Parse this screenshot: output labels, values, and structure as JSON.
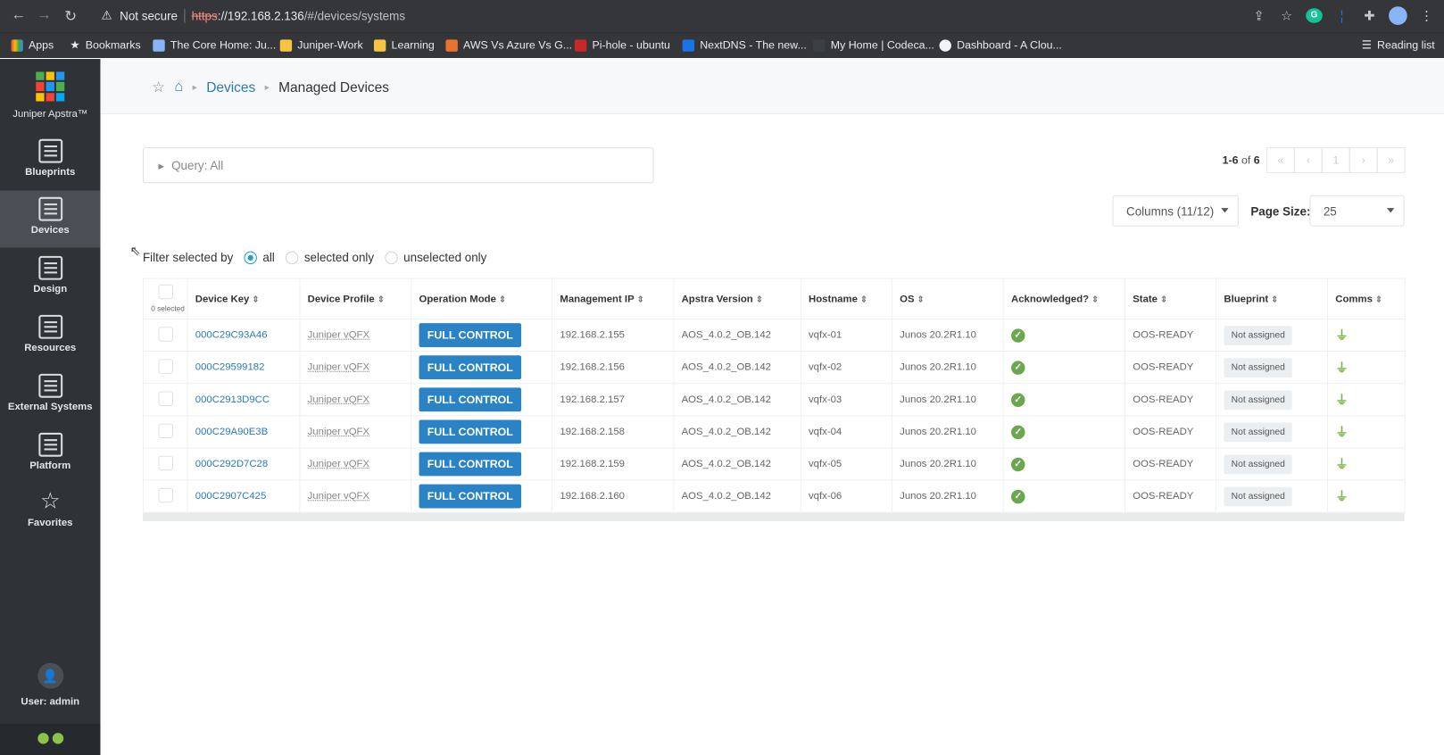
{
  "browser": {
    "not_secure": "Not secure",
    "url_proto": "https",
    "url_host": "://192.168.2.136",
    "url_path": "/#/devices/systems",
    "bookmarks": [
      {
        "label": "Apps",
        "color": "#ea4335"
      },
      {
        "label": "Bookmarks",
        "color": "#e8eaed"
      },
      {
        "label": "The Core Home: Ju...",
        "color": "#8ab4f8"
      },
      {
        "label": "Juniper-Work",
        "color": "#f6c343"
      },
      {
        "label": "Learning",
        "color": "#f6c343"
      },
      {
        "label": "AWS Vs Azure Vs G...",
        "color": "#e8732e"
      },
      {
        "label": "Pi-hole - ubuntu",
        "color": "#c62828"
      },
      {
        "label": "NextDNS - The new...",
        "color": "#1a73e8"
      },
      {
        "label": "My Home | Codeca...",
        "color": "#3c4043"
      },
      {
        "label": "Dashboard - A Clou...",
        "color": "#f1f3f4"
      }
    ],
    "reading_list": "Reading list"
  },
  "sidebar": {
    "product": "Juniper Apstra™",
    "items": [
      {
        "label": "Blueprints"
      },
      {
        "label": "Devices"
      },
      {
        "label": "Design"
      },
      {
        "label": "Resources"
      },
      {
        "label": "External Systems"
      },
      {
        "label": "Platform"
      },
      {
        "label": "Favorites"
      }
    ],
    "user": "User: admin"
  },
  "breadcrumb": {
    "devices": "Devices",
    "current": "Managed Devices"
  },
  "query": "Query: All",
  "pagination": {
    "range": "1-6",
    "of": "of",
    "total": "6",
    "page": "1"
  },
  "columns_button": "Columns (11/12)",
  "page_size": {
    "label": "Page Size:",
    "value": "25"
  },
  "filter": {
    "label": "Filter selected by",
    "options": [
      "all",
      "selected only",
      "unselected only"
    ],
    "selected": "all"
  },
  "table": {
    "selected_count": "0 selected",
    "headers": [
      "Device Key",
      "Device Profile",
      "Operation Mode",
      "Management IP",
      "Apstra Version",
      "Hostname",
      "OS",
      "Acknowledged?",
      "State",
      "Blueprint",
      "Comms"
    ],
    "rows": [
      {
        "key": "000C29C93A46",
        "profile": "Juniper vQFX",
        "mode": "FULL CONTROL",
        "ip": "192.168.2.155",
        "version": "AOS_4.0.2_OB.142",
        "hostname": "vqfx-01",
        "os": "Junos 20.2R1.10",
        "state": "OOS-READY",
        "blueprint": "Not assigned"
      },
      {
        "key": "000C29599182",
        "profile": "Juniper vQFX",
        "mode": "FULL CONTROL",
        "ip": "192.168.2.156",
        "version": "AOS_4.0.2_OB.142",
        "hostname": "vqfx-02",
        "os": "Junos 20.2R1.10",
        "state": "OOS-READY",
        "blueprint": "Not assigned"
      },
      {
        "key": "000C2913D9CC",
        "profile": "Juniper vQFX",
        "mode": "FULL CONTROL",
        "ip": "192.168.2.157",
        "version": "AOS_4.0.2_OB.142",
        "hostname": "vqfx-03",
        "os": "Junos 20.2R1.10",
        "state": "OOS-READY",
        "blueprint": "Not assigned"
      },
      {
        "key": "000C29A90E3B",
        "profile": "Juniper vQFX",
        "mode": "FULL CONTROL",
        "ip": "192.168.2.158",
        "version": "AOS_4.0.2_OB.142",
        "hostname": "vqfx-04",
        "os": "Junos 20.2R1.10",
        "state": "OOS-READY",
        "blueprint": "Not assigned"
      },
      {
        "key": "000C292D7C28",
        "profile": "Juniper vQFX",
        "mode": "FULL CONTROL",
        "ip": "192.168.2.159",
        "version": "AOS_4.0.2_OB.142",
        "hostname": "vqfx-05",
        "os": "Junos 20.2R1.10",
        "state": "OOS-READY",
        "blueprint": "Not assigned"
      },
      {
        "key": "000C2907C425",
        "profile": "Juniper vQFX",
        "mode": "FULL CONTROL",
        "ip": "192.168.2.160",
        "version": "AOS_4.0.2_OB.142",
        "hostname": "vqfx-06",
        "os": "Junos 20.2R1.10",
        "state": "OOS-READY",
        "blueprint": "Not assigned"
      }
    ]
  },
  "colors": {
    "accent": "#2a83c4",
    "link": "#2a7ab8",
    "sidebar": "#2f3338",
    "ack_green": "#6aa84f"
  }
}
